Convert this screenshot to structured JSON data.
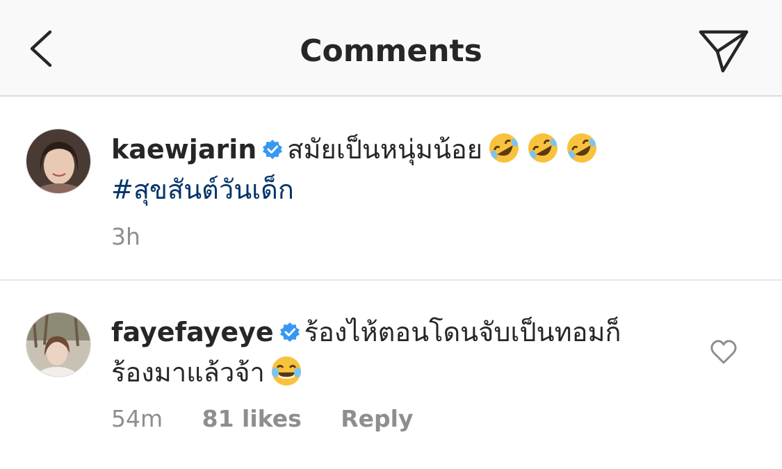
{
  "header": {
    "title": "Comments"
  },
  "comments": [
    {
      "username": "kaewjarin",
      "text": "สมัยเป็นหนุ่มน้อย",
      "hashtag": "#สุขสันต์วันเด็ก",
      "time": "3h"
    },
    {
      "username": "fayefayeye",
      "text": "ร้องไห้ตอนโดนจับเป็นทอมก็ร้องมาแล้วจ้า",
      "time": "54m",
      "likes": "81 likes",
      "reply_label": "Reply"
    }
  ],
  "icons": {
    "back": "chevron-left-icon",
    "send": "paper-plane-icon",
    "verified": "verified-badge-icon",
    "like": "heart-outline-icon",
    "emoji_1": "rolling-on-floor-laughing-emoji",
    "emoji_2": "face-with-tears-of-joy-emoji"
  },
  "colors": {
    "verified_blue": "#3897f0",
    "hashtag": "#003569",
    "meta_gray": "#8e8e8e",
    "emoji_yellow": "#f9c23c"
  }
}
